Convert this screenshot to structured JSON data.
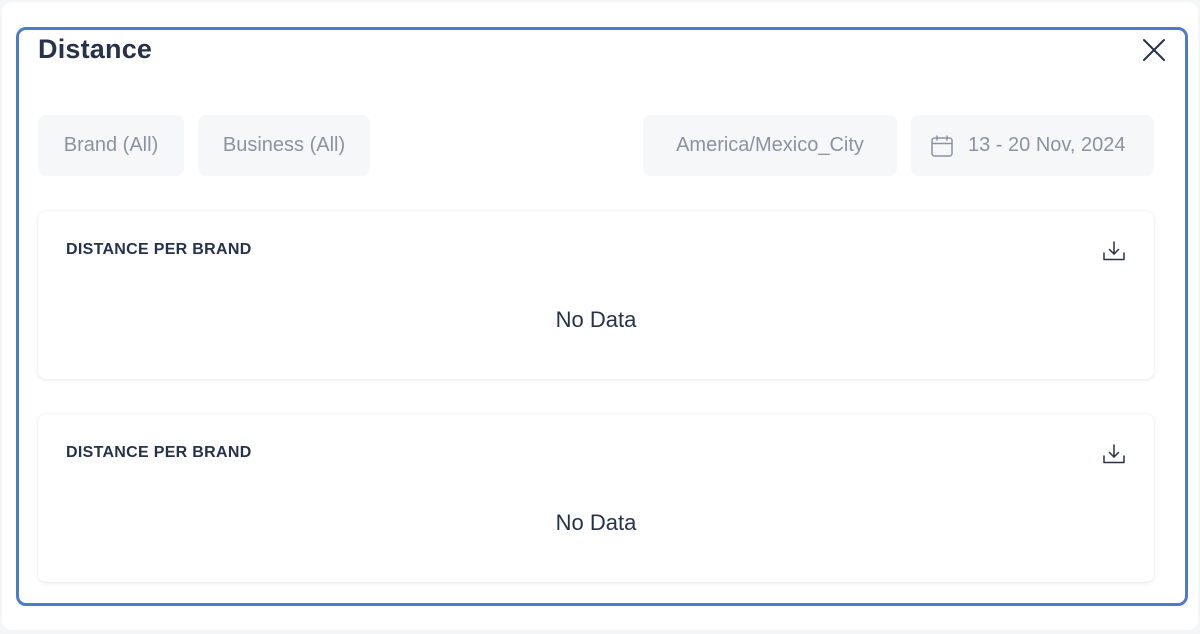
{
  "modal": {
    "title": "Distance"
  },
  "filters": {
    "brand": "Brand (All)",
    "business": "Business (All)",
    "timezone": "America/Mexico_City",
    "date_range": "13 - 20 Nov, 2024"
  },
  "cards": [
    {
      "title": "DISTANCE PER BRAND",
      "empty_text": "No Data"
    },
    {
      "title": "DISTANCE PER BRAND",
      "empty_text": "No Data"
    }
  ],
  "icons": {
    "close": "close-icon",
    "calendar": "calendar-icon",
    "download": "download-icon"
  },
  "colors": {
    "modal_border": "#4a7bd0",
    "title_text": "#25324a",
    "filter_bg": "#f6f7f9",
    "filter_text": "#8a93a3"
  }
}
